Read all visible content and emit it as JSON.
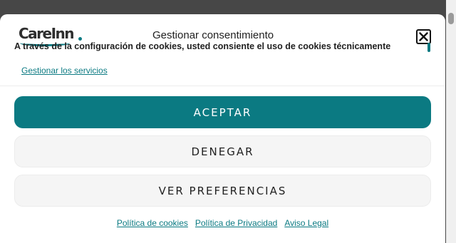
{
  "modal": {
    "logo_text": "CareInn",
    "title": "Gestionar consentimiento",
    "message": "A través de la configuración de cookies, usted consiente el uso de cookies técnicamente",
    "manage_link": "Gestionar los servicios"
  },
  "buttons": {
    "accept": "ACEPTAR",
    "deny": "DENEGAR",
    "preferences": "VER PREFERENCIAS"
  },
  "footer": {
    "links": [
      "Política de cookies",
      "Política de Privacidad",
      "Aviso Legal"
    ]
  },
  "colors": {
    "accent": "#0b7a82",
    "overlay": "#474747",
    "button_secondary": "#f5f5f5"
  },
  "icons": {
    "close": "close-icon"
  }
}
